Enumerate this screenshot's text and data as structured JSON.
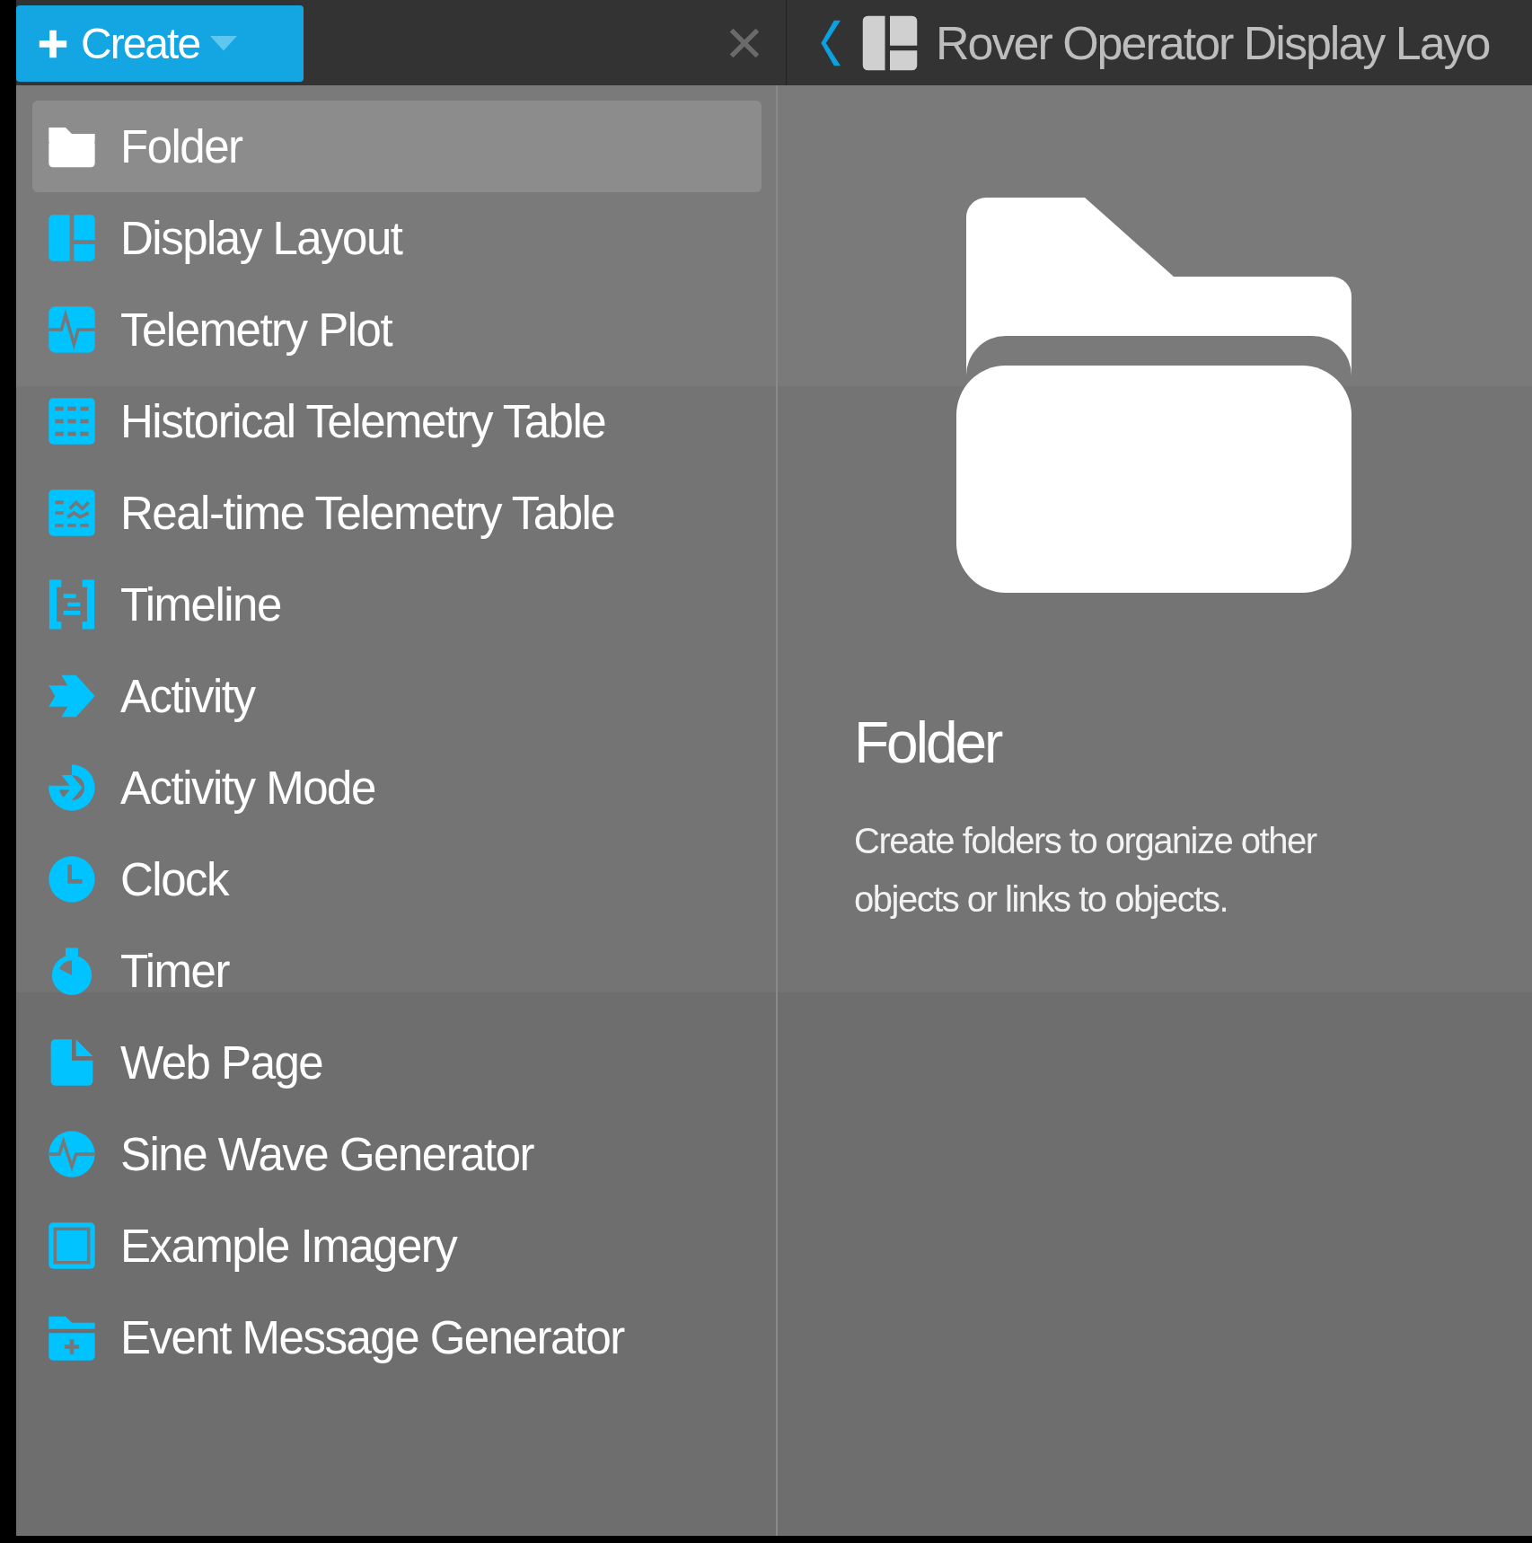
{
  "toolbar": {
    "create_button": {
      "label": "Create"
    },
    "object_title": "Rover Operator Display Layo"
  },
  "create_menu": {
    "items": [
      {
        "label": "Folder",
        "kind": "folder",
        "selected": true
      },
      {
        "label": "Display Layout",
        "kind": "layout",
        "selected": false
      },
      {
        "label": "Telemetry Plot",
        "kind": "plot",
        "selected": false
      },
      {
        "label": "Historical Telemetry Table",
        "kind": "table",
        "selected": false
      },
      {
        "label": "Real-time Telemetry Table",
        "kind": "rttable",
        "selected": false
      },
      {
        "label": "Timeline",
        "kind": "timeline",
        "selected": false
      },
      {
        "label": "Activity",
        "kind": "activity",
        "selected": false
      },
      {
        "label": "Activity Mode",
        "kind": "mode",
        "selected": false
      },
      {
        "label": "Clock",
        "kind": "clock",
        "selected": false
      },
      {
        "label": "Timer",
        "kind": "timer",
        "selected": false
      },
      {
        "label": "Web Page",
        "kind": "page",
        "selected": false
      },
      {
        "label": "Sine Wave Generator",
        "kind": "sine",
        "selected": false
      },
      {
        "label": "Example Imagery",
        "kind": "image",
        "selected": false
      },
      {
        "label": "Event Message Generator",
        "kind": "event",
        "selected": false
      }
    ]
  },
  "preview": {
    "title": "Folder",
    "description": "Create folders to organize other objects or links to objects."
  }
}
